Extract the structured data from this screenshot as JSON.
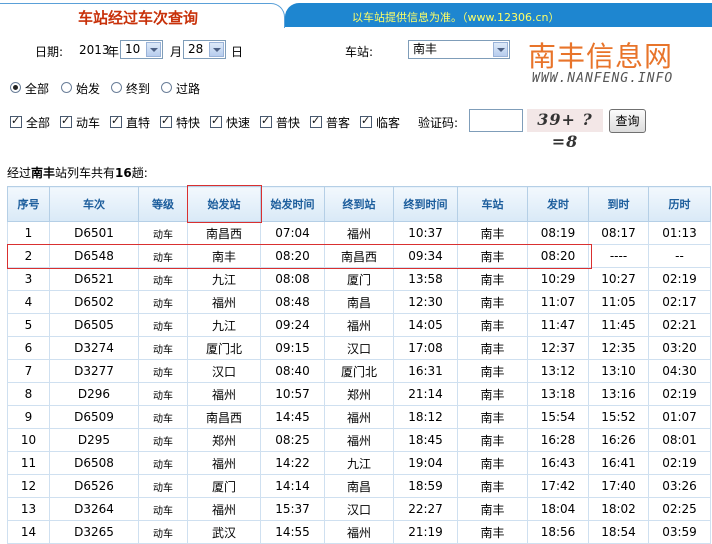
{
  "header": {
    "title": "车站经过车次查询",
    "note": "以车站提供信息为准。（www.12306.cn）"
  },
  "form": {
    "date_label": "日期:",
    "year_value": "2013",
    "year_unit": "年",
    "month_value": "10",
    "month_unit": "月",
    "day_value": "28",
    "day_unit": "日",
    "station_label": "车站:",
    "station_value": "南丰",
    "scope_options": [
      "全部",
      "始发",
      "终到",
      "过路"
    ],
    "scope_selected": "全部",
    "type_options": [
      "全部",
      "动车",
      "直特",
      "特快",
      "快速",
      "普快",
      "普客",
      "临客"
    ],
    "captcha_label": "验证码:",
    "captcha_value": "",
    "captcha_image_text": "39+ ?=8",
    "query_button": "查询"
  },
  "logo": {
    "cn": "南丰信息网",
    "en": "WWW.NANFENG.INFO"
  },
  "summary": {
    "prefix": "经过",
    "station": "南丰",
    "middle": "站列车共有",
    "count": "16",
    "suffix": "趟:"
  },
  "table": {
    "columns": [
      "序号",
      "车次",
      "等级",
      "始发站",
      "始发时间",
      "终到站",
      "终到时间",
      "车站",
      "发时",
      "到时",
      "历时"
    ],
    "rows": [
      [
        "1",
        "D6501",
        "动车",
        "南昌西",
        "07:04",
        "福州",
        "10:37",
        "南丰",
        "08:19",
        "08:17",
        "01:13"
      ],
      [
        "2",
        "D6548",
        "动车",
        "南丰",
        "08:20",
        "南昌西",
        "09:34",
        "南丰",
        "08:20",
        "----",
        "--"
      ],
      [
        "3",
        "D6521",
        "动车",
        "九江",
        "08:08",
        "厦门",
        "13:58",
        "南丰",
        "10:29",
        "10:27",
        "02:19"
      ],
      [
        "4",
        "D6502",
        "动车",
        "福州",
        "08:48",
        "南昌",
        "12:30",
        "南丰",
        "11:07",
        "11:05",
        "02:17"
      ],
      [
        "5",
        "D6505",
        "动车",
        "九江",
        "09:24",
        "福州",
        "14:05",
        "南丰",
        "11:47",
        "11:45",
        "02:21"
      ],
      [
        "6",
        "D3274",
        "动车",
        "厦门北",
        "09:15",
        "汉口",
        "17:08",
        "南丰",
        "12:37",
        "12:35",
        "03:20"
      ],
      [
        "7",
        "D3277",
        "动车",
        "汉口",
        "08:40",
        "厦门北",
        "16:31",
        "南丰",
        "13:12",
        "13:10",
        "04:30"
      ],
      [
        "8",
        "D296",
        "动车",
        "福州",
        "10:57",
        "郑州",
        "21:14",
        "南丰",
        "13:18",
        "13:16",
        "02:19"
      ],
      [
        "9",
        "D6509",
        "动车",
        "南昌西",
        "14:45",
        "福州",
        "18:12",
        "南丰",
        "15:54",
        "15:52",
        "01:07"
      ],
      [
        "10",
        "D295",
        "动车",
        "郑州",
        "08:25",
        "福州",
        "18:45",
        "南丰",
        "16:28",
        "16:26",
        "08:01"
      ],
      [
        "11",
        "D6508",
        "动车",
        "福州",
        "14:22",
        "九江",
        "19:04",
        "南丰",
        "16:43",
        "16:41",
        "02:19"
      ],
      [
        "12",
        "D6526",
        "动车",
        "厦门",
        "14:14",
        "南昌",
        "18:59",
        "南丰",
        "17:42",
        "17:40",
        "03:26"
      ],
      [
        "13",
        "D3264",
        "动车",
        "福州",
        "15:37",
        "汉口",
        "22:27",
        "南丰",
        "18:04",
        "18:02",
        "02:25"
      ],
      [
        "14",
        "D3265",
        "动车",
        "武汉",
        "14:55",
        "福州",
        "21:19",
        "南丰",
        "18:56",
        "18:54",
        "03:59"
      ]
    ]
  },
  "colors": {
    "title": "#c8310a",
    "banner": "#1e86d0",
    "header_text": "#1c5d9c",
    "highlight_box": "#d93030",
    "logo": "#e8742a"
  }
}
